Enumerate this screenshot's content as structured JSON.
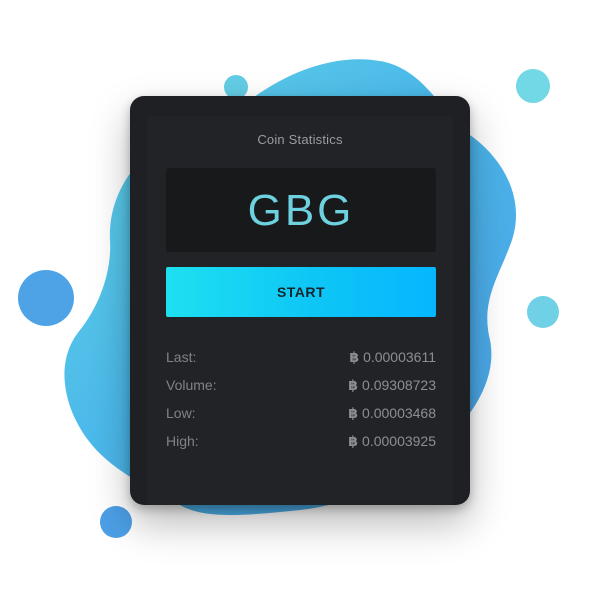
{
  "widget": {
    "title": "Coin Statistics",
    "symbol": "GBG",
    "start_label": "START"
  },
  "stats": [
    {
      "label": "Last:",
      "currency_icon": "bitcoin-icon",
      "currency_symbol": "฿",
      "value": "0.00003611"
    },
    {
      "label": "Volume:",
      "currency_icon": "bitcoin-icon",
      "currency_symbol": "฿",
      "value": "0.09308723"
    },
    {
      "label": "Low:",
      "currency_icon": "bitcoin-icon",
      "currency_symbol": "฿",
      "value": "0.00003468"
    },
    {
      "label": "High:",
      "currency_icon": "bitcoin-icon",
      "currency_symbol": "฿",
      "value": "0.00003925"
    }
  ],
  "colors": {
    "accent": "#1ee0f0",
    "symbol_text": "#6ed1df",
    "card_background": "#1f2023",
    "blob_cyan": "#6fd8e6",
    "blob_blue": "#55a8e8"
  }
}
